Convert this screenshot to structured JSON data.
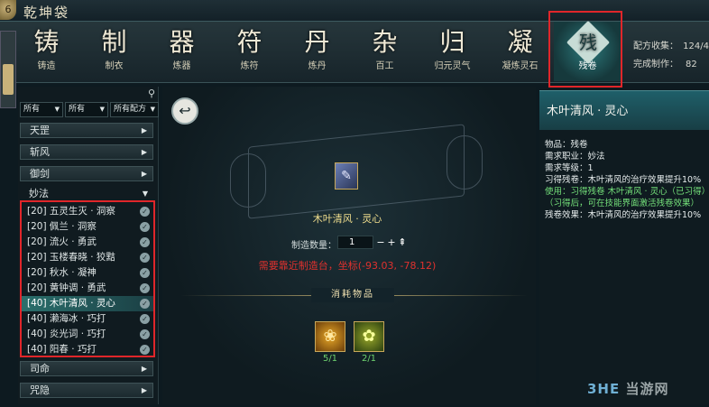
{
  "window": {
    "logo": "6",
    "title": "乾坤袋"
  },
  "tabs": [
    {
      "glyph": "铸",
      "label": "铸造"
    },
    {
      "glyph": "制",
      "label": "制衣"
    },
    {
      "glyph": "器",
      "label": "炼器"
    },
    {
      "glyph": "符",
      "label": "炼符"
    },
    {
      "glyph": "丹",
      "label": "炼丹"
    },
    {
      "glyph": "杂",
      "label": "百工"
    },
    {
      "glyph": "归",
      "label": "归元灵气"
    },
    {
      "glyph": "凝",
      "label": "凝炼灵石"
    },
    {
      "glyph": "残",
      "label": "残卷"
    }
  ],
  "stats": {
    "collect_label": "配方收集：",
    "collect_value": "124/4",
    "made_label": "完成制作：",
    "made_value": "82"
  },
  "filters": [
    {
      "label": "所有"
    },
    {
      "label": "所有"
    },
    {
      "label": "所有配方"
    }
  ],
  "categories": [
    {
      "label": "天罡",
      "arrow": "▶"
    },
    {
      "label": "斩风",
      "arrow": "▶"
    },
    {
      "label": "御剑",
      "arrow": "▶"
    },
    {
      "label": "妙法",
      "arrow": "▼"
    },
    {
      "label": "司命",
      "arrow": "▶"
    },
    {
      "label": "咒隐",
      "arrow": "▶"
    }
  ],
  "recipes": [
    {
      "label": "[20] 五灵生灭 · 洞察"
    },
    {
      "label": "[20] 佩兰 · 洞察"
    },
    {
      "label": "[20] 流火 · 勇武"
    },
    {
      "label": "[20] 玉楼春晓 · 狡黠"
    },
    {
      "label": "[20] 秋水 · 凝神"
    },
    {
      "label": "[20] 黄钟调 · 勇武"
    },
    {
      "label": "[40] 木叶清风 · 灵心"
    },
    {
      "label": "[40] 濑海冰 · 巧打"
    },
    {
      "label": "[40] 炎光词 · 巧打"
    },
    {
      "label": "[40] 阳春 · 巧打"
    }
  ],
  "selected_recipe_index": 6,
  "center": {
    "item_name": "木叶清风 · 灵心",
    "qty_label": "制造数量：",
    "qty_value": "1",
    "warning": "需要靠近制造台，坐标(-93.03, -78.12)",
    "consume_title": "消耗物品",
    "materials": [
      {
        "count": "5/1"
      },
      {
        "count": "2/1"
      }
    ]
  },
  "detail": {
    "title": "木叶清风 · 灵心",
    "lines": [
      "物品：残卷",
      "需求职业：妙法",
      "需求等级：1",
      "习得残卷：木叶清风的治疗效果提升10%"
    ],
    "use_line": "使用：习得残卷 木叶清风 · 灵心（已习得）",
    "use_note": "（习得后，可在技能界面激活残卷效果）",
    "effect_line": "残卷效果：木叶清风的治疗效果提升10%"
  },
  "watermark": {
    "left": "3HE",
    "right": "当游网"
  },
  "colors": {
    "highlight_box": "#e0262a",
    "warning": "#e0312e",
    "item_name": "#f2df8e",
    "use_text": "#74e07a"
  }
}
